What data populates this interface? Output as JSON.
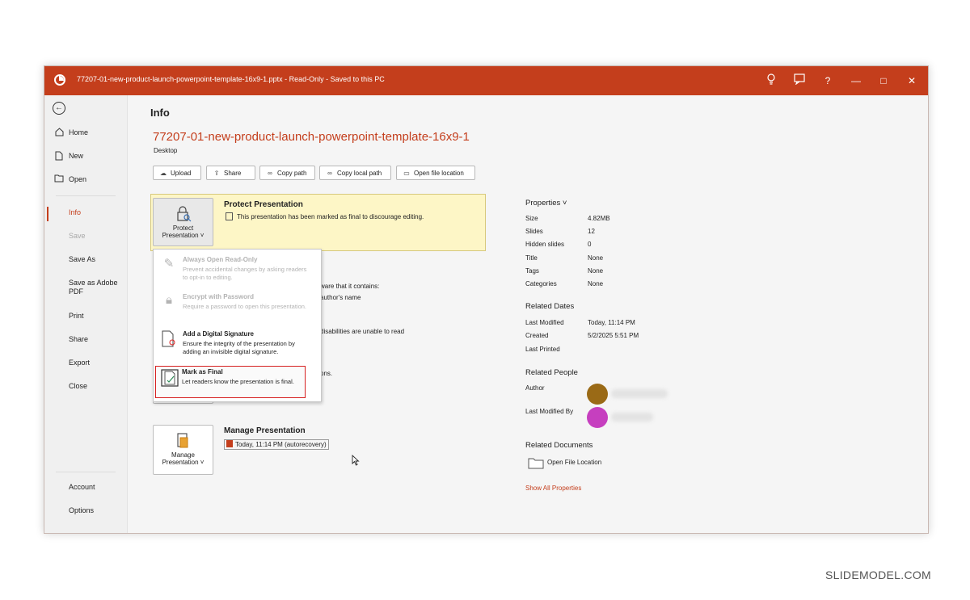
{
  "window": {
    "title": "77207-01-new-product-launch-powerpoint-template-16x9-1.pptx  -  Read-Only  -  Saved to this PC",
    "controls": [
      "lightbulb-icon",
      "feedback-icon",
      "help-icon",
      "minimize-icon",
      "maximize-icon",
      "close-icon"
    ],
    "help_glyph": "?",
    "minimize_glyph": "—",
    "maximize_glyph": "□",
    "close_glyph": "✕",
    "accent": "#c43e1c"
  },
  "sidebar": {
    "items": [
      {
        "label": "Home",
        "icon": "home-icon"
      },
      {
        "label": "New",
        "icon": "new-file-icon"
      },
      {
        "label": "Open",
        "icon": "folder-open-icon"
      },
      {
        "label": "Info"
      },
      {
        "label": "Save"
      },
      {
        "label": "Save As"
      },
      {
        "label": "Save as Adobe PDF"
      },
      {
        "label": "Print"
      },
      {
        "label": "Share"
      },
      {
        "label": "Export"
      },
      {
        "label": "Close"
      },
      {
        "label": "Account"
      },
      {
        "label": "Options"
      }
    ]
  },
  "info": {
    "heading": "Info",
    "file_name": "77207-01-new-product-launch-powerpoint-template-16x9-1",
    "location": "Desktop",
    "buttons": [
      "Upload",
      "Share",
      "Copy path",
      "Copy local path",
      "Open file location"
    ]
  },
  "protect": {
    "button_line1": "Protect",
    "button_line2": "Presentation ˅",
    "title": "Protect Presentation",
    "desc": "This presentation has been marked as final to discourage editing."
  },
  "inspect_partial": {
    "line1": "ware that it contains:",
    "line2": "author's name",
    "line3": "disabilities are unable to read",
    "line4": "ons."
  },
  "protect_menu": {
    "items": [
      {
        "title": "Always Open Read-Only",
        "desc": "Prevent accidental changes by asking readers to opt-in to editing."
      },
      {
        "title": "Encrypt with Password",
        "desc": "Require a password to open this presentation."
      },
      {
        "title": "Add a Digital Signature",
        "desc": "Ensure the integrity of the presentation by adding an invisible digital signature."
      },
      {
        "title": "Mark as Final",
        "desc": "Let readers know the presentation is final."
      }
    ]
  },
  "manage": {
    "button_line1": "Manage",
    "button_line2": "Presentation ˅",
    "title": "Manage Presentation",
    "version": "Today, 11:14 PM (autorecovery)"
  },
  "properties": {
    "heading": "Properties ˅",
    "rows": [
      {
        "key": "Size",
        "value": "4.82MB"
      },
      {
        "key": "Slides",
        "value": "12"
      },
      {
        "key": "Hidden slides",
        "value": "0"
      },
      {
        "key": "Title",
        "value": "None"
      },
      {
        "key": "Tags",
        "value": "None"
      },
      {
        "key": "Categories",
        "value": "None"
      }
    ],
    "related_dates_heading": "Related Dates",
    "dates": [
      {
        "key": "Last Modified",
        "value": "Today, 11:14 PM"
      },
      {
        "key": "Created",
        "value": "5/2/2025 5:51 PM"
      },
      {
        "key": "Last Printed",
        "value": ""
      }
    ],
    "related_people_heading": "Related People",
    "author_label": "Author",
    "last_modified_by_label": "Last Modified By",
    "author_color": "#9a6a16",
    "modifier_color": "#c63fbf",
    "related_docs_heading": "Related Documents",
    "open_file_location": "Open File Location",
    "show_all": "Show All Properties"
  },
  "watermark": "SLIDEMODEL.COM"
}
